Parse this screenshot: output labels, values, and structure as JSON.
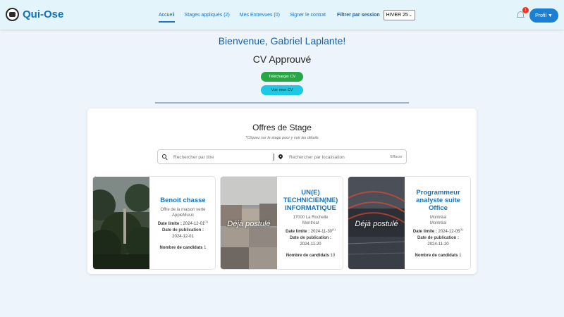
{
  "nav": {
    "brand": "Qui-Ose",
    "links": [
      {
        "label": "Accueil",
        "active": true
      },
      {
        "label": "Stages appliqués (2)",
        "active": false
      },
      {
        "label": "Mes Entrevues (0)",
        "active": false
      },
      {
        "label": "Signer le contrat",
        "active": false
      }
    ],
    "filter_label": "Filtrer par session",
    "session_value": "HIVER 25",
    "notification_count": "1",
    "profile_label": "Profil ▼"
  },
  "welcome": "Bienvenue, Gabriel Laplante!",
  "cv_status": "CV Approuvé",
  "buttons": {
    "download": "Télécharger CV",
    "view": "Voir mon CV"
  },
  "offers": {
    "title": "Offres de Stage",
    "subtitle": "*Cliquez sur le stage pour y voir les détails",
    "search_placeholder": "Rechercher par titre",
    "location_placeholder": "Rechercher par localisation",
    "clear_label": "Effacer",
    "applied_label": "Déjà postulé",
    "date_limit_label": "Date limite :",
    "pub_label": "Date de publication :",
    "candidates_label": "Nombre de candidats",
    "cards": [
      {
        "title": "Benoit chasse",
        "line1": "Offre de la maison verte",
        "line2": "AppleMusic",
        "deadline": "2024-12-01",
        "deadline_sup": "(1)",
        "published": "2024-12-01",
        "candidates": "1",
        "applied": false
      },
      {
        "title": "UN(E) TECHNICIEN(NE) INFORMATIQUE",
        "line1": "17000 La Rochelle",
        "line2": "Montréal",
        "deadline": "2024-11-30",
        "deadline_sup": "(1)",
        "published": "2024-11-20",
        "candidates": "10",
        "applied": true
      },
      {
        "title": "Programmeur analyste suite Office",
        "line1": "Montréal",
        "line2": "Montréal",
        "deadline": "2024-12-05",
        "deadline_sup": "(1)",
        "published": "2024-11-20",
        "candidates": "1",
        "applied": true
      }
    ]
  },
  "colors": {
    "brand": "#1473b8",
    "download_button": "#28a745",
    "view_button": "#1cc8e3",
    "profile_button": "#1b80d4",
    "badge": "#e32222"
  }
}
